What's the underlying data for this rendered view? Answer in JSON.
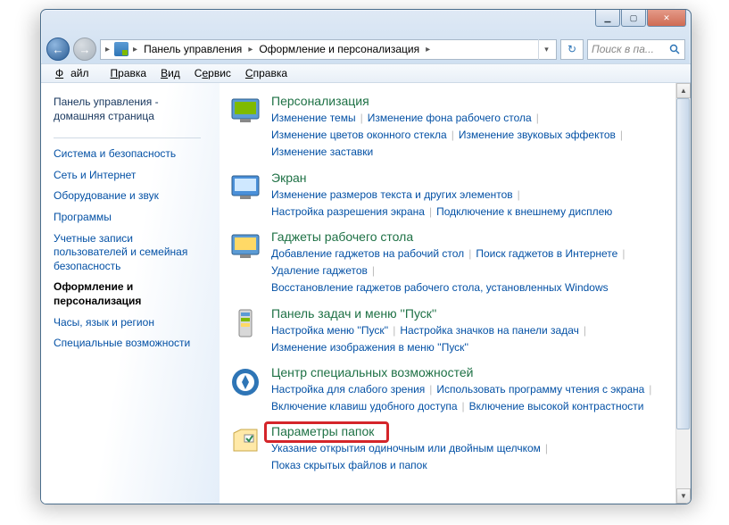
{
  "window_controls": {
    "min": "▁",
    "max": "▢",
    "close": "✕"
  },
  "nav": {
    "back": "←",
    "forward": "→"
  },
  "breadcrumb": {
    "seg1": "Панель управления",
    "seg2": "Оформление и персонализация"
  },
  "refresh_glyph": "↻",
  "search": {
    "placeholder": "Поиск в па..."
  },
  "menu": {
    "file": "Файл",
    "edit": "Правка",
    "view": "Вид",
    "tools": "Сервис",
    "help": "Справка"
  },
  "sidebar": {
    "home": "Панель управления - домашняя страница",
    "items": [
      "Система и безопасность",
      "Сеть и Интернет",
      "Оборудование и звук",
      "Программы",
      "Учетные записи пользователей и семейная безопасность"
    ],
    "current": "Оформление и персонализация",
    "after": [
      "Часы, язык и регион",
      "Специальные возможности"
    ]
  },
  "categories": [
    {
      "title": "Персонализация",
      "links": [
        "Изменение темы",
        "Изменение фона рабочего стола",
        "Изменение цветов оконного стекла",
        "Изменение звуковых эффектов",
        "Изменение заставки"
      ]
    },
    {
      "title": "Экран",
      "links": [
        "Изменение размеров текста и других элементов",
        "Настройка разрешения экрана",
        "Подключение к внешнему дисплею"
      ]
    },
    {
      "title": "Гаджеты рабочего стола",
      "links": [
        "Добавление гаджетов на рабочий стол",
        "Поиск гаджетов в Интернете",
        "Удаление гаджетов",
        "Восстановление гаджетов рабочего стола, установленных Windows"
      ]
    },
    {
      "title": "Панель задач и меню ''Пуск''",
      "links": [
        "Настройка меню ''Пуск''",
        "Настройка значков на панели задач",
        "Изменение изображения в меню ''Пуск''"
      ]
    },
    {
      "title": "Центр специальных возможностей",
      "links": [
        "Настройка для слабого зрения",
        "Использовать программу чтения с экрана",
        "Включение клавиш удобного доступа",
        "Включение высокой контрастности"
      ]
    },
    {
      "title": "Параметры папок",
      "links": [
        "Указание открытия одиночным или двойным щелчком",
        "Показ скрытых файлов и папок"
      ]
    }
  ],
  "scroll": {
    "up": "▲",
    "down": "▼"
  }
}
